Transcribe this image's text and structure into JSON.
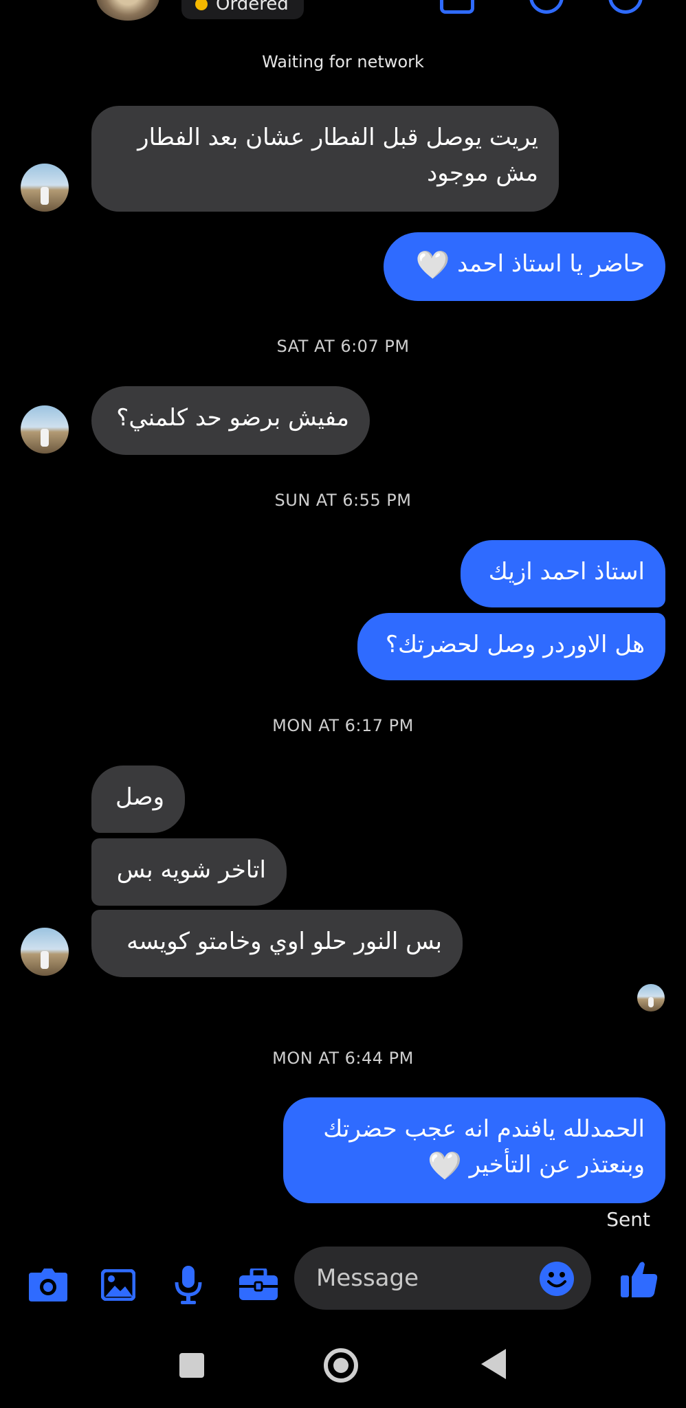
{
  "header": {
    "order_status": "Ordered"
  },
  "network_status": "Waiting for network",
  "timestamps": [
    "SAT AT 6:07 PM",
    "SUN AT 6:55 PM",
    "MON AT 6:17 PM",
    "MON AT 6:44 PM"
  ],
  "messages": [
    {
      "side": "in",
      "text": "يريت يوصل قبل الفطار عشان بعد الفطار مش موجود"
    },
    {
      "side": "out",
      "text": "حاضر يا استاذ احمد",
      "emoji": "🤍"
    },
    {
      "side": "in",
      "text": "مفيش برضو حد كلمني؟"
    },
    {
      "side": "out",
      "text": "استاذ احمد ازيك"
    },
    {
      "side": "out",
      "text": "هل الاوردر وصل لحضرتك؟"
    },
    {
      "side": "in",
      "text": "وصل"
    },
    {
      "side": "in",
      "text": "اتاخر شويه بس"
    },
    {
      "side": "in",
      "text": "بس النور حلو اوي وخامتو كويسه"
    },
    {
      "side": "out",
      "text": "الحمدلله يافندم انه عجب حضرتك وبنعتذر عن التأخير",
      "emoji": "🤍"
    }
  ],
  "delivery_status": "Sent",
  "composer": {
    "placeholder": "Message",
    "icons": [
      "camera-icon",
      "image-icon",
      "microphone-icon",
      "briefcase-icon",
      "emoji-icon",
      "thumbs-up-icon"
    ]
  },
  "colors": {
    "accent": "#2f6bff",
    "incoming_bubble": "#3a3a3c",
    "background": "#000000",
    "badge_dot": "#f5b800"
  }
}
